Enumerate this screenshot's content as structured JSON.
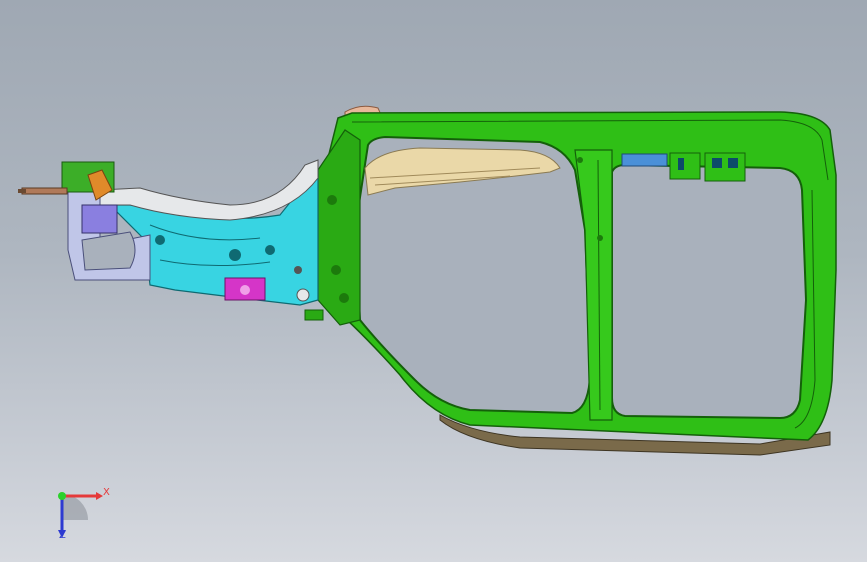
{
  "viewport": {
    "model": "side-body-inner-structure",
    "background": [
      "#9fa8b3",
      "#d6d9df"
    ]
  },
  "colors": {
    "frame_green": "#2fbf16",
    "frame_dark": "#1c7a0c",
    "cyan_part": "#38d4e2",
    "magenta_part": "#d535c8",
    "purple_part": "#8a7fe0",
    "orange_part": "#e08a2a",
    "beige_part": "#ead8a8",
    "sill_brown": "#7a6a4a"
  },
  "triad": {
    "x_label": "X",
    "z_label": "Z",
    "x_color": "#e53a3a",
    "y_color": "#2bd12b",
    "z_color": "#2d3ad1"
  }
}
